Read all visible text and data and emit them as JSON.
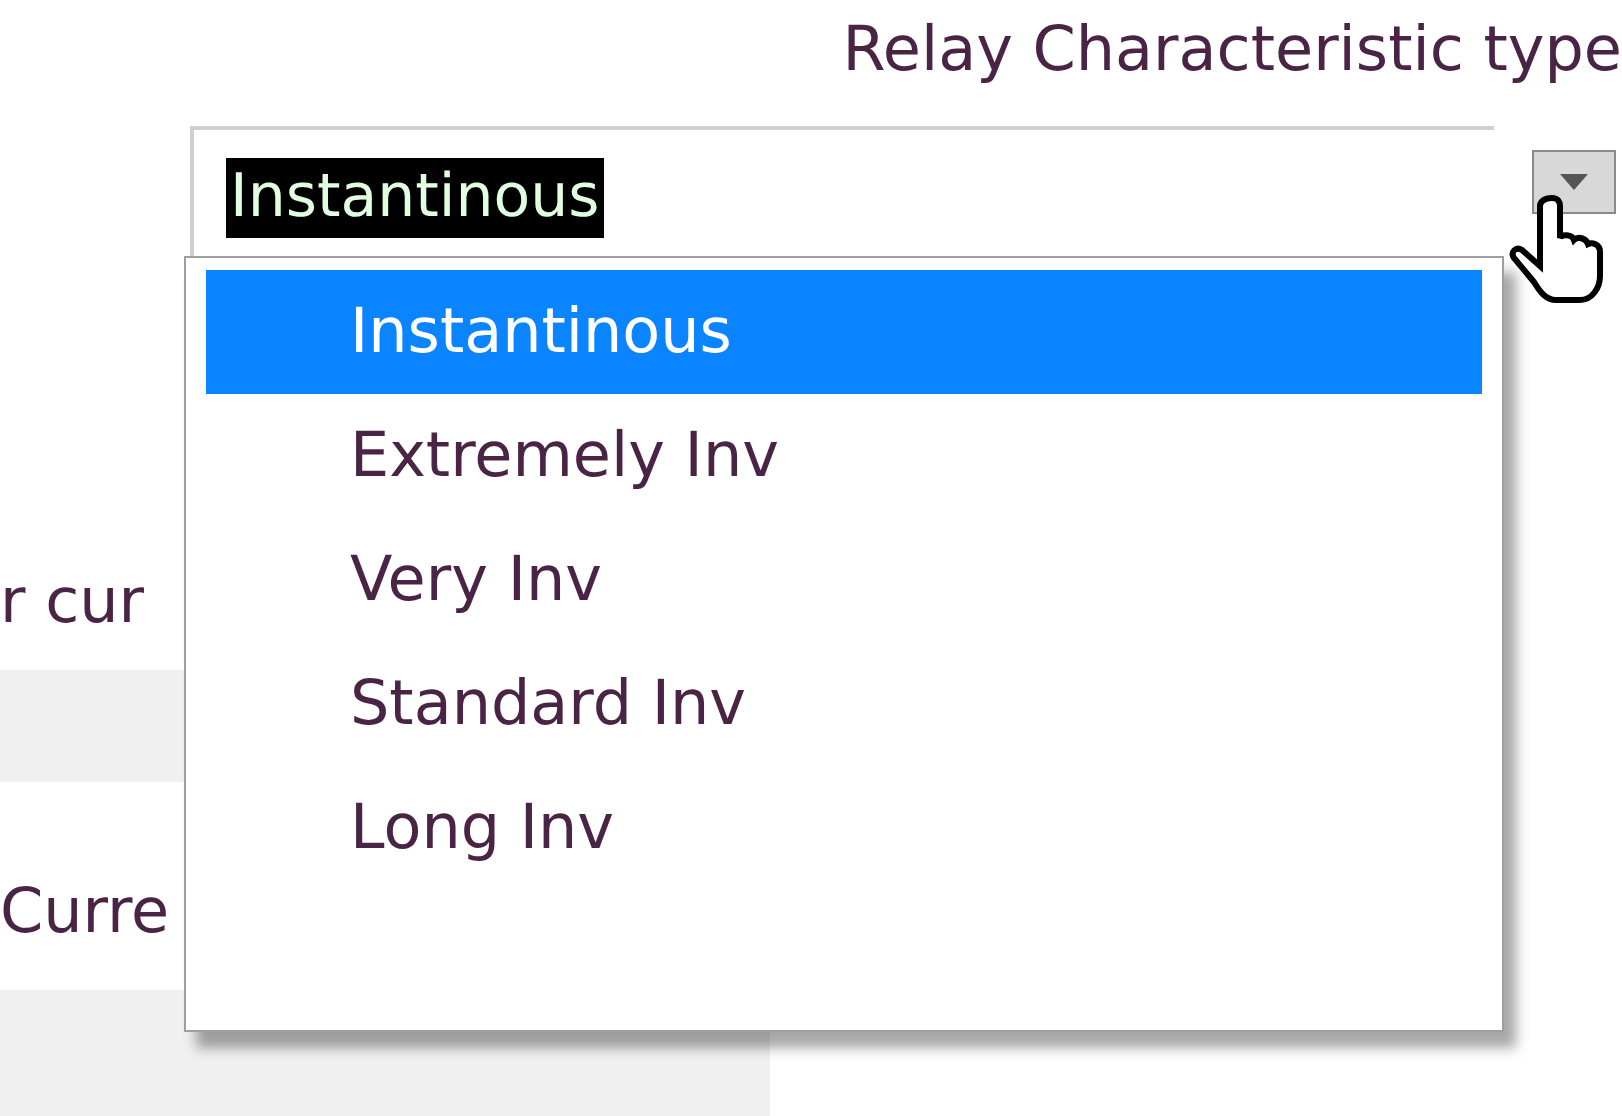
{
  "field_label": "Relay Characteristic type",
  "combo": {
    "value": "Instantinous"
  },
  "options": [
    {
      "label": "Instantinous",
      "selected": true
    },
    {
      "label": "Extremely Inv",
      "selected": false
    },
    {
      "label": "Very Inv",
      "selected": false
    },
    {
      "label": "Standard Inv",
      "selected": false
    },
    {
      "label": "Long Inv",
      "selected": false
    }
  ],
  "background_labels": [
    "r cur",
    "Curre"
  ]
}
